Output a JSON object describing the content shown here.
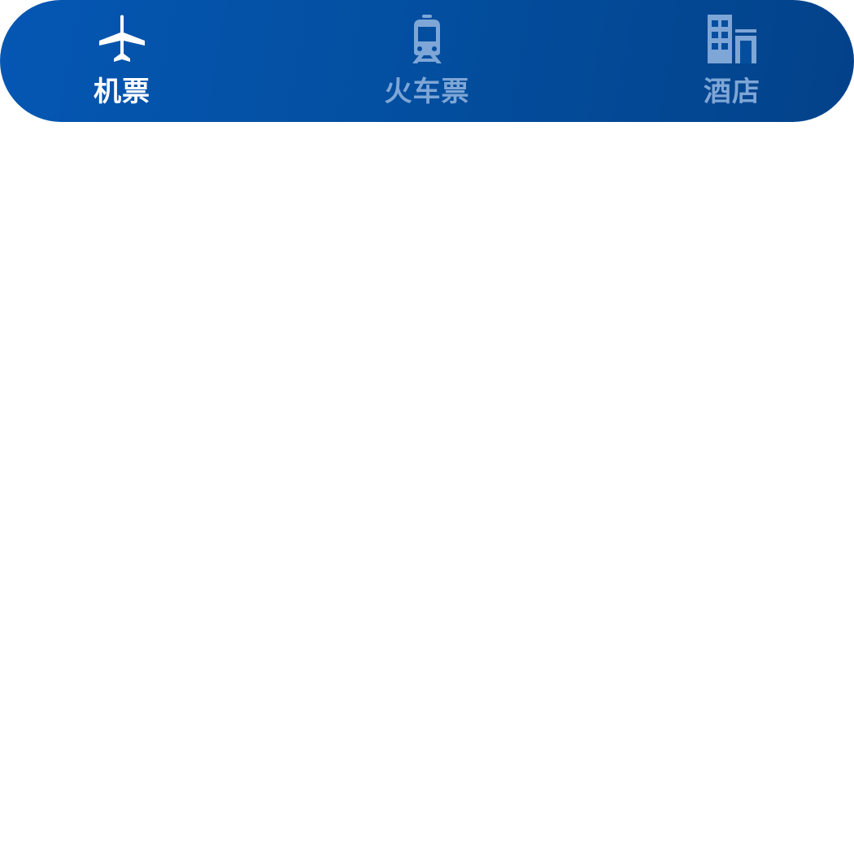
{
  "tabs": [
    {
      "label": "机票",
      "icon": "airplane-icon",
      "active": true
    },
    {
      "label": "火车票",
      "icon": "train-icon",
      "active": false
    },
    {
      "label": "酒店",
      "icon": "hotel-icon",
      "active": false
    }
  ],
  "colors": {
    "bar_gradient_start": "#0557b3",
    "bar_gradient_end": "#03428a",
    "active": "#ffffff",
    "inactive": "#7ea6d6"
  }
}
